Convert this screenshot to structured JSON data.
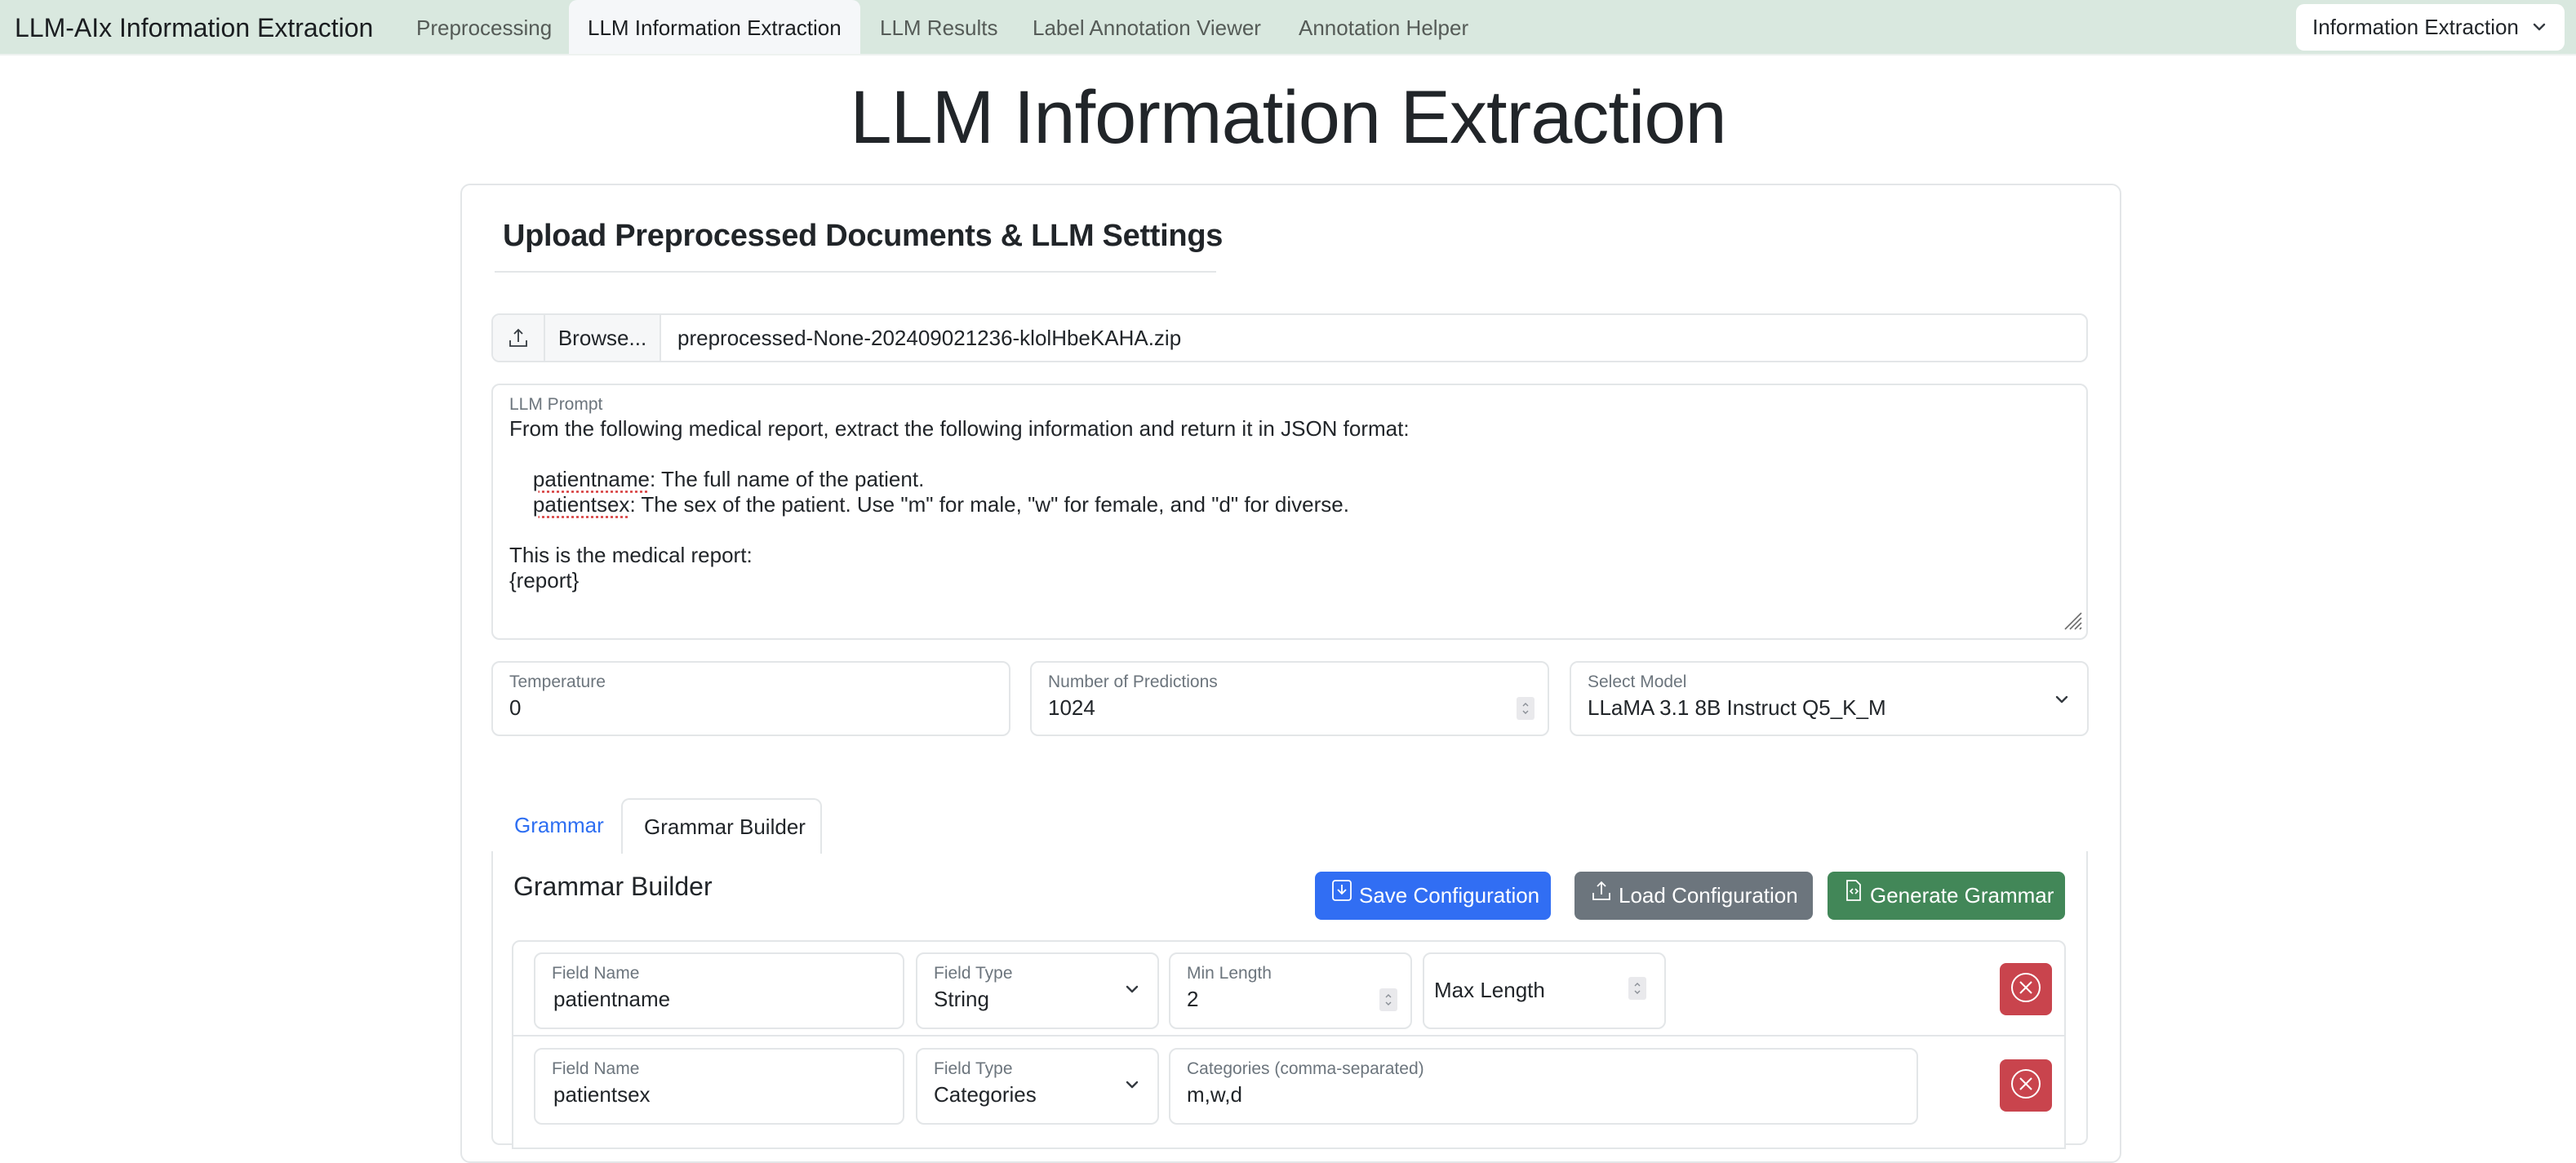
{
  "navbar": {
    "brand": "LLM-AIx Information Extraction",
    "items": [
      {
        "label": "Preprocessing",
        "active": false
      },
      {
        "label": "LLM Information Extraction",
        "active": true
      },
      {
        "label": "LLM Results",
        "active": false
      },
      {
        "label": "Label Annotation Viewer",
        "active": false
      },
      {
        "label": "Annotation Helper",
        "active": false
      }
    ],
    "mode_select": {
      "value": "Information Extraction",
      "icon": "chevron-down-icon"
    }
  },
  "page": {
    "title": "LLM Information Extraction"
  },
  "upload": {
    "section_title": "Upload Preprocessed Documents & LLM Settings",
    "upload_icon": "upload-icon",
    "browse_label": "Browse...",
    "file_name": "preprocessed-None-202409021236-klolHbeKAHA.zip"
  },
  "prompt": {
    "label": "LLM Prompt",
    "line1": "From the following medical report, extract the following information and return it in JSON format:",
    "line2_key": "patientname",
    "line2_rest": ": The full name of the patient.",
    "line3_key": "patientsex",
    "line3_rest": ": The sex of the patient. Use \"m\" for male, \"w\" for female, and \"d\" for diverse.",
    "line4": "This is the medical report:",
    "line5": "{report}"
  },
  "settings": {
    "temperature": {
      "label": "Temperature",
      "value": "0"
    },
    "predictions": {
      "label": "Number of Predictions",
      "value": "1024"
    },
    "model": {
      "label": "Select Model",
      "value": "LLaMA 3.1 8B Instruct Q5_K_M"
    }
  },
  "tabs": [
    {
      "label": "Grammar",
      "active": false
    },
    {
      "label": "Grammar Builder",
      "active": true
    }
  ],
  "builder": {
    "title": "Grammar Builder",
    "buttons": {
      "save": "Save Configuration",
      "load": "Load Configuration",
      "generate": "Generate Grammar"
    },
    "colors": {
      "save": "#316ef3",
      "load": "#6c757d",
      "generate": "#428758",
      "delete": "#c9444d"
    },
    "fields": [
      {
        "name_label": "Field Name",
        "name": "patientname",
        "type_label": "Field Type",
        "type": "String",
        "min_label": "Min Length",
        "min": "2",
        "max_placeholder": "Max Length"
      },
      {
        "name_label": "Field Name",
        "name": "patientsex",
        "type_label": "Field Type",
        "type": "Categories",
        "categories_label": "Categories (comma-separated)",
        "categories": "m,w,d"
      }
    ]
  }
}
